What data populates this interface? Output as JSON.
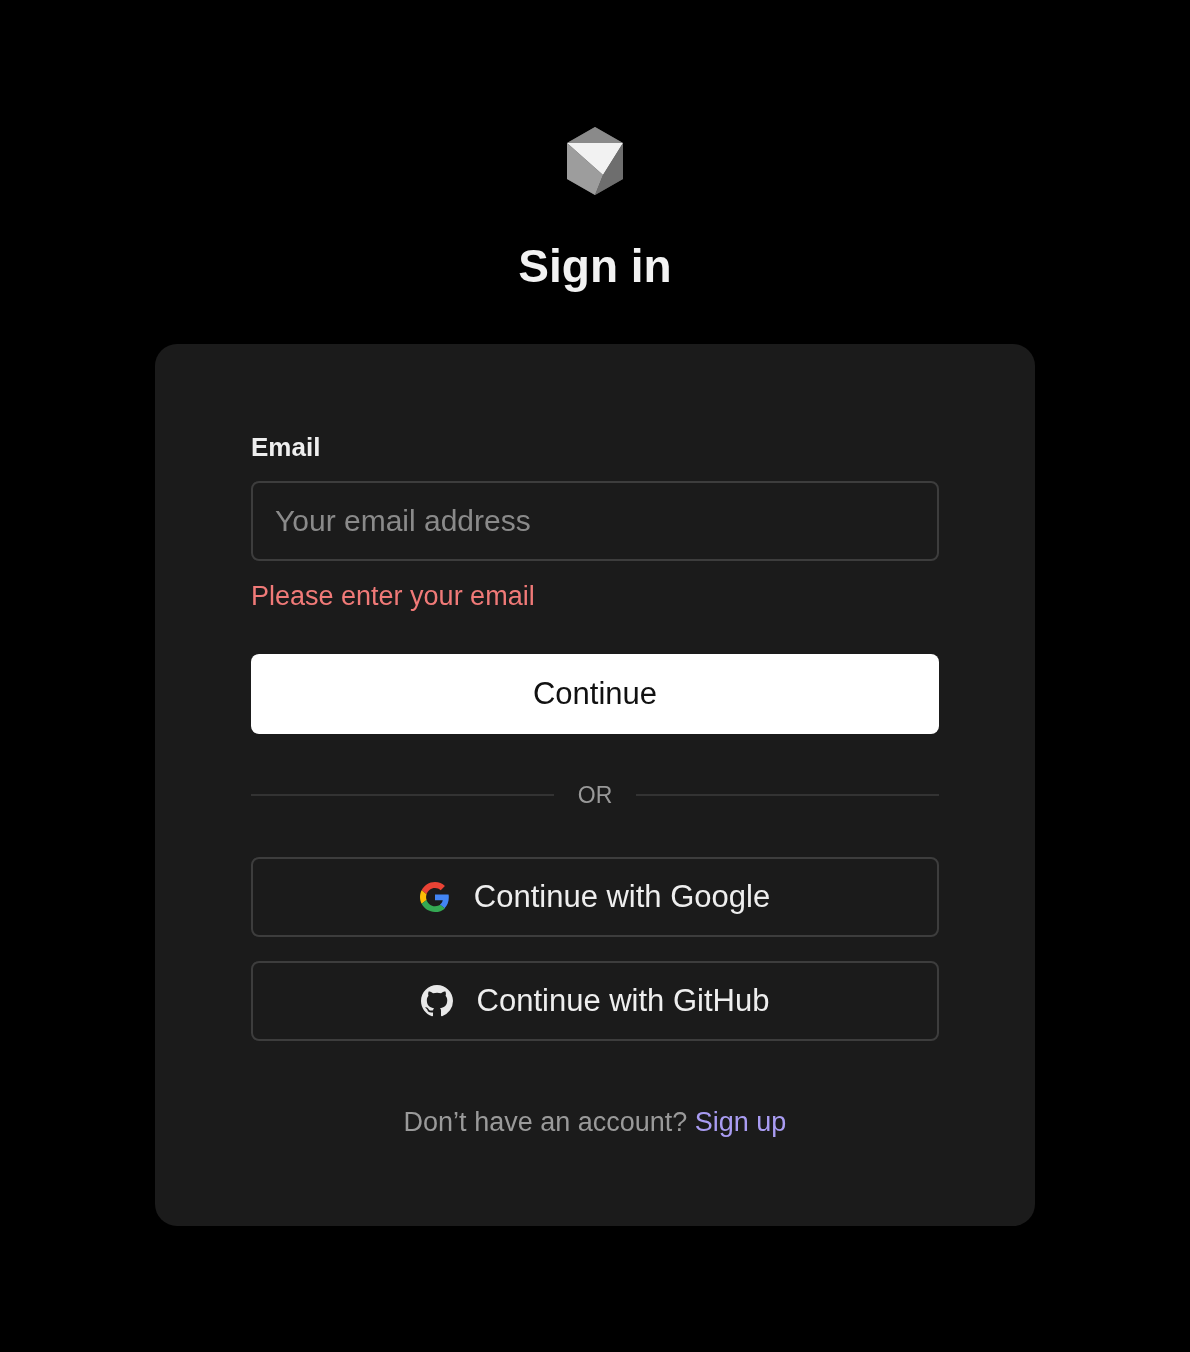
{
  "title": "Sign in",
  "email": {
    "label": "Email",
    "placeholder": "Your email address",
    "error": "Please enter your email"
  },
  "continue_button": "Continue",
  "divider": "OR",
  "providers": [
    {
      "kind": "google",
      "label": "Continue with Google"
    },
    {
      "kind": "github",
      "label": "Continue with GitHub"
    }
  ],
  "footer": {
    "text": "Don’t have an account?",
    "link": "Sign up"
  }
}
